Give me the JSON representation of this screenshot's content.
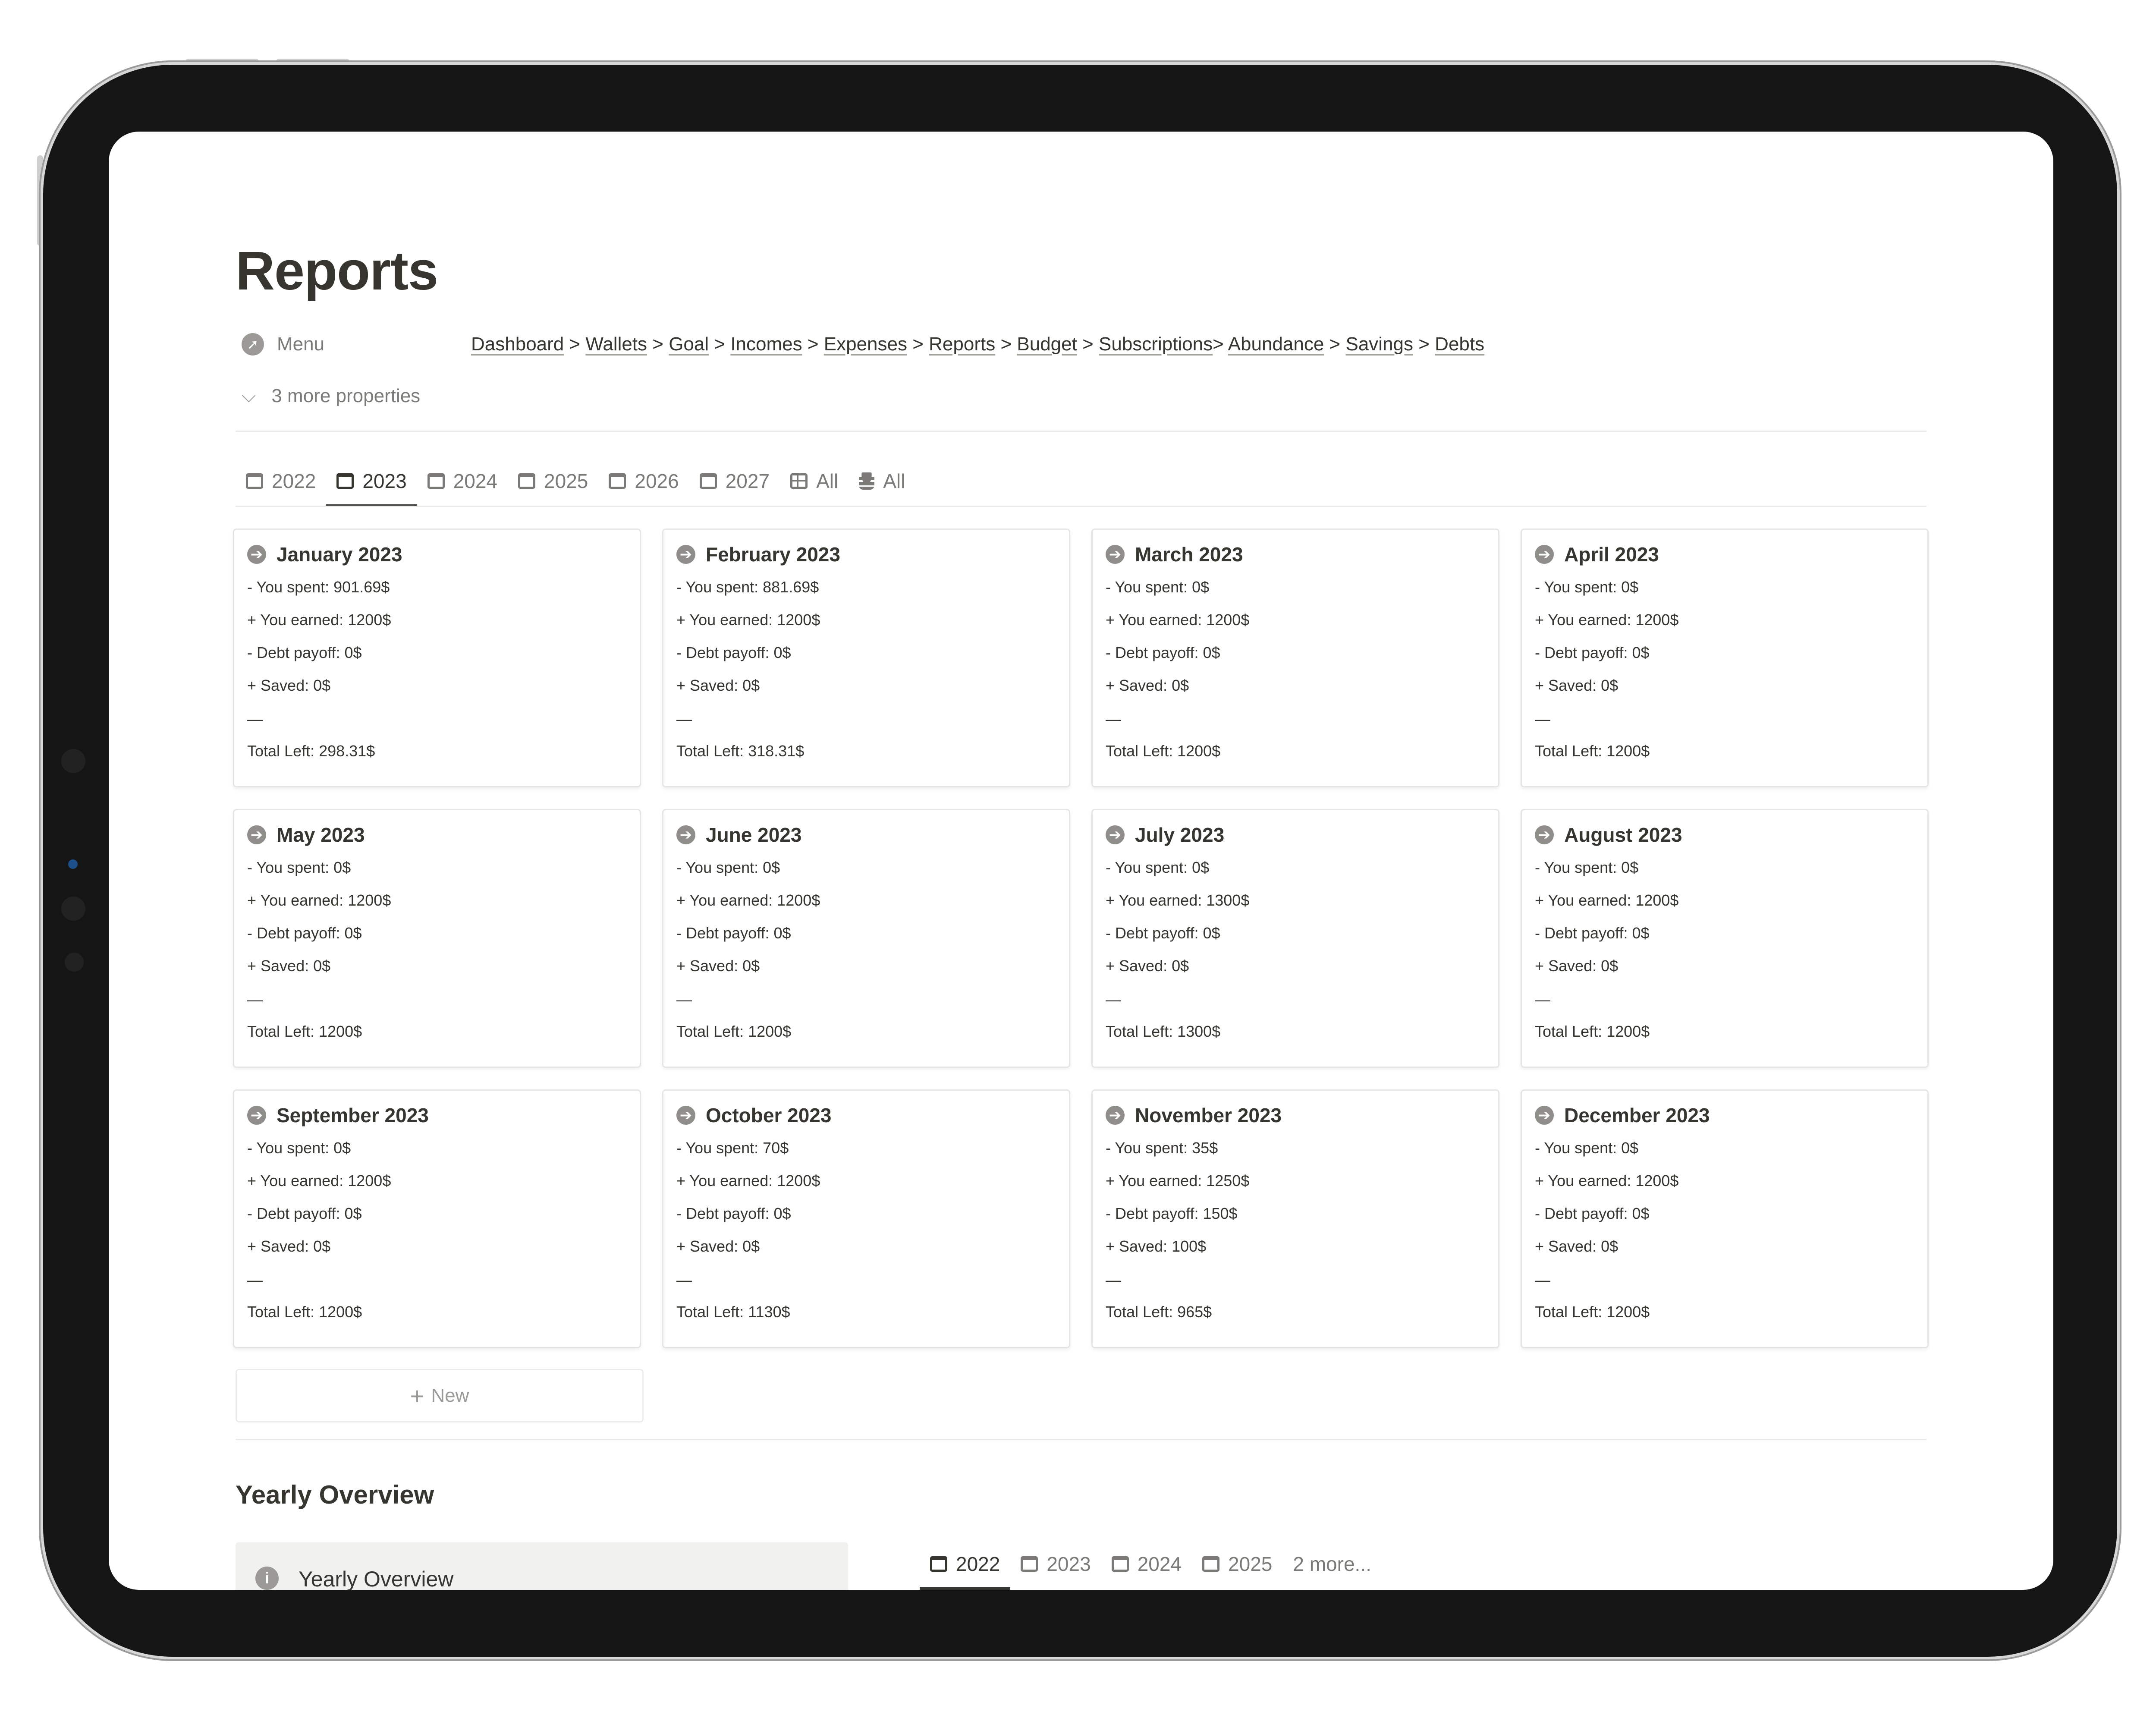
{
  "page": {
    "title": "Reports",
    "menu_label": "Menu",
    "more_properties": "3 more properties"
  },
  "breadcrumb": [
    "Dashboard",
    "Wallets",
    "Goal",
    "Incomes",
    "Expenses",
    "Reports",
    "Budget",
    "Subscriptions",
    "Abundance",
    "Savings",
    "Debts"
  ],
  "tabs": [
    {
      "label": "2022",
      "icon": "calendar-icon",
      "active": false
    },
    {
      "label": "2023",
      "icon": "calendar-icon",
      "active": true
    },
    {
      "label": "2024",
      "icon": "calendar-icon",
      "active": false
    },
    {
      "label": "2025",
      "icon": "calendar-icon",
      "active": false
    },
    {
      "label": "2026",
      "icon": "calendar-icon",
      "active": false
    },
    {
      "label": "2027",
      "icon": "calendar-icon",
      "active": false
    },
    {
      "label": "All",
      "icon": "table-icon",
      "active": false
    },
    {
      "label": "All",
      "icon": "database-icon",
      "active": false
    }
  ],
  "cards": [
    {
      "month": "January 2023",
      "spent": "- You spent:  901.69$",
      "earned": "+ You earned:  1200$",
      "debt": "- Debt payoff: 0$",
      "saved": "+ Saved: 0$",
      "sep": "—",
      "total": "Total Left: 298.31$"
    },
    {
      "month": "February 2023",
      "spent": "- You spent:  881.69$",
      "earned": "+ You earned:  1200$",
      "debt": "- Debt payoff: 0$",
      "saved": "+ Saved: 0$",
      "sep": "—",
      "total": "Total Left: 318.31$"
    },
    {
      "month": "March 2023",
      "spent": "- You spent:  0$",
      "earned": "+ You earned:  1200$",
      "debt": "- Debt payoff: 0$",
      "saved": "+ Saved: 0$",
      "sep": "—",
      "total": "Total Left: 1200$"
    },
    {
      "month": "April 2023",
      "spent": "- You spent:  0$",
      "earned": "+ You earned:  1200$",
      "debt": "- Debt payoff: 0$",
      "saved": "+ Saved: 0$",
      "sep": "—",
      "total": "Total Left: 1200$"
    },
    {
      "month": "May 2023",
      "spent": "- You spent:  0$",
      "earned": "+ You earned:  1200$",
      "debt": "- Debt payoff: 0$",
      "saved": "+ Saved: 0$",
      "sep": "—",
      "total": "Total Left: 1200$"
    },
    {
      "month": "June 2023",
      "spent": "- You spent:  0$",
      "earned": "+ You earned:  1200$",
      "debt": "- Debt payoff: 0$",
      "saved": "+ Saved: 0$",
      "sep": "—",
      "total": "Total Left: 1200$"
    },
    {
      "month": "July 2023",
      "spent": "- You spent:  0$",
      "earned": "+ You earned:  1300$",
      "debt": "- Debt payoff: 0$",
      "saved": "+ Saved: 0$",
      "sep": "—",
      "total": "Total Left: 1300$"
    },
    {
      "month": "August 2023",
      "spent": "- You spent:  0$",
      "earned": "+ You earned:  1200$",
      "debt": "- Debt payoff: 0$",
      "saved": "+ Saved: 0$",
      "sep": "—",
      "total": "Total Left: 1200$"
    },
    {
      "month": "September 2023",
      "spent": "- You spent:  0$",
      "earned": "+ You earned:  1200$",
      "debt": "- Debt payoff: 0$",
      "saved": "+ Saved: 0$",
      "sep": "—",
      "total": "Total Left: 1200$"
    },
    {
      "month": "October 2023",
      "spent": "- You spent:  70$",
      "earned": "+ You earned:  1200$",
      "debt": "- Debt payoff: 0$",
      "saved": "+ Saved: 0$",
      "sep": "—",
      "total": "Total Left: 1130$"
    },
    {
      "month": "November 2023",
      "spent": "- You spent:  35$",
      "earned": "+ You earned:  1250$",
      "debt": "- Debt payoff: 150$",
      "saved": "+ Saved: 100$",
      "sep": "—",
      "total": "Total Left: 965$"
    },
    {
      "month": "December 2023",
      "spent": "- You spent:  0$",
      "earned": "+ You earned:  1200$",
      "debt": "- Debt payoff: 0$",
      "saved": "+ Saved: 0$",
      "sep": "—",
      "total": "Total Left: 1200$"
    }
  ],
  "new_button": "New",
  "yearly": {
    "heading": "Yearly Overview",
    "callout_text": "Yearly Overview",
    "tabs": [
      {
        "label": "2022",
        "active": true
      },
      {
        "label": "2023",
        "active": false
      },
      {
        "label": "2024",
        "active": false
      },
      {
        "label": "2025",
        "active": false
      }
    ],
    "more": "2 more..."
  },
  "colors": {
    "text": "#37352f",
    "muted": "#7b7a76",
    "border": "#e5e5e3",
    "frame": "#151515"
  }
}
